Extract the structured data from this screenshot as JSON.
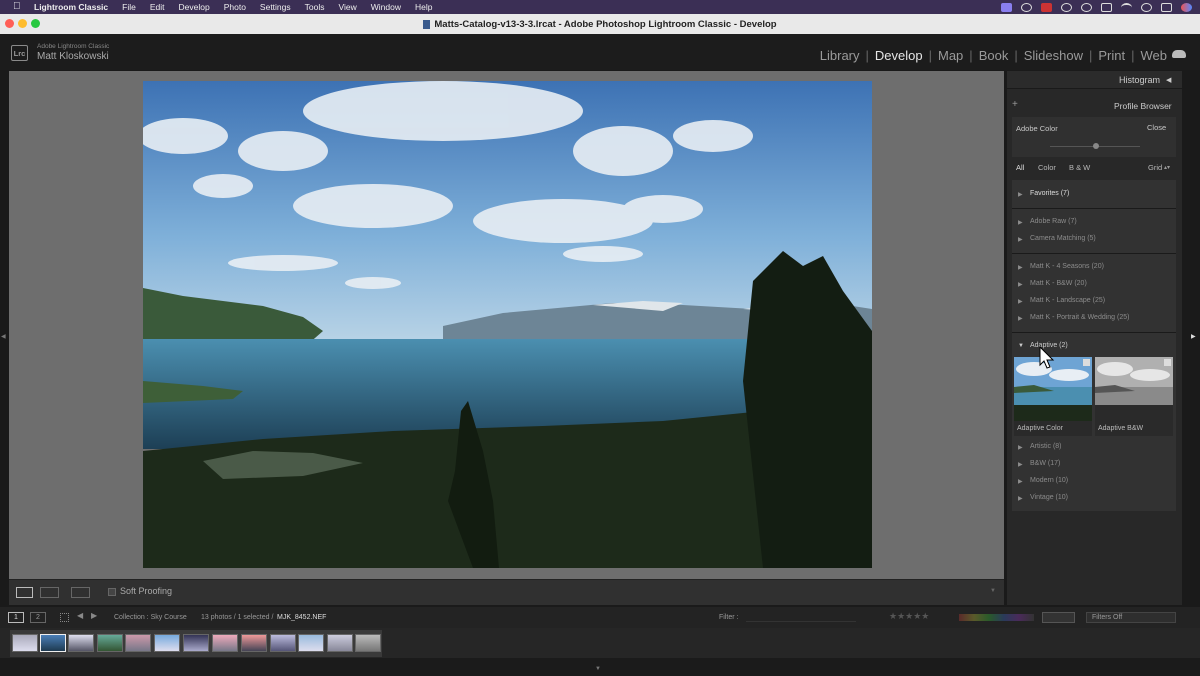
{
  "menubar": {
    "app_name": "Lightroom Classic",
    "items": [
      "File",
      "Edit",
      "Develop",
      "Photo",
      "Settings",
      "Tools",
      "View",
      "Window",
      "Help"
    ]
  },
  "window": {
    "title": "Matts-Catalog-v13-3-3.lrcat - Adobe Photoshop Lightroom Classic - Develop"
  },
  "identity": {
    "logo": "Lrc",
    "product": "Adobe Lightroom Classic",
    "user": "Matt Kloskowski"
  },
  "modules": {
    "items": [
      "Library",
      "Develop",
      "Map",
      "Book",
      "Slideshow",
      "Print",
      "Web"
    ],
    "active": "Develop"
  },
  "panel": {
    "histogram": "Histogram",
    "plus": "+",
    "profile_browser": "Profile Browser",
    "current_profile": "Adobe Color",
    "close": "Close",
    "filters": [
      "All",
      "Color",
      "B & W"
    ],
    "grid_label": "Grid",
    "groups": [
      {
        "label": "Favorites (7)"
      },
      {
        "label": "Adobe Raw (7)"
      },
      {
        "label": "Camera Matching (5)"
      },
      {
        "label": "Matt K - 4 Seasons (20)"
      },
      {
        "label": "Matt K - B&W (20)"
      },
      {
        "label": "Matt K - Landscape (25)"
      },
      {
        "label": "Matt K - Portrait & Wedding (25)"
      },
      {
        "label": "Adaptive (2)"
      },
      {
        "label": "Artistic (8)"
      },
      {
        "label": "B&W (17)"
      },
      {
        "label": "Modern (10)"
      },
      {
        "label": "Vintage (10)"
      }
    ],
    "adaptive_thumbs": [
      "Adaptive Color",
      "Adaptive B&W"
    ]
  },
  "toolbar": {
    "soft_proofing": "Soft Proofing"
  },
  "filmstrip": {
    "screen1": "1",
    "screen2": "2",
    "source": "Collection : Sky Course",
    "count": "13 photos / 1 selected /",
    "filename": "MJK_8452.NEF",
    "filter_label": "Filter :",
    "filter_value": "Filters Off"
  },
  "colors": {
    "menubar": "#3b2f55",
    "panel": "#282828",
    "canvas": "#6e6e6e"
  }
}
